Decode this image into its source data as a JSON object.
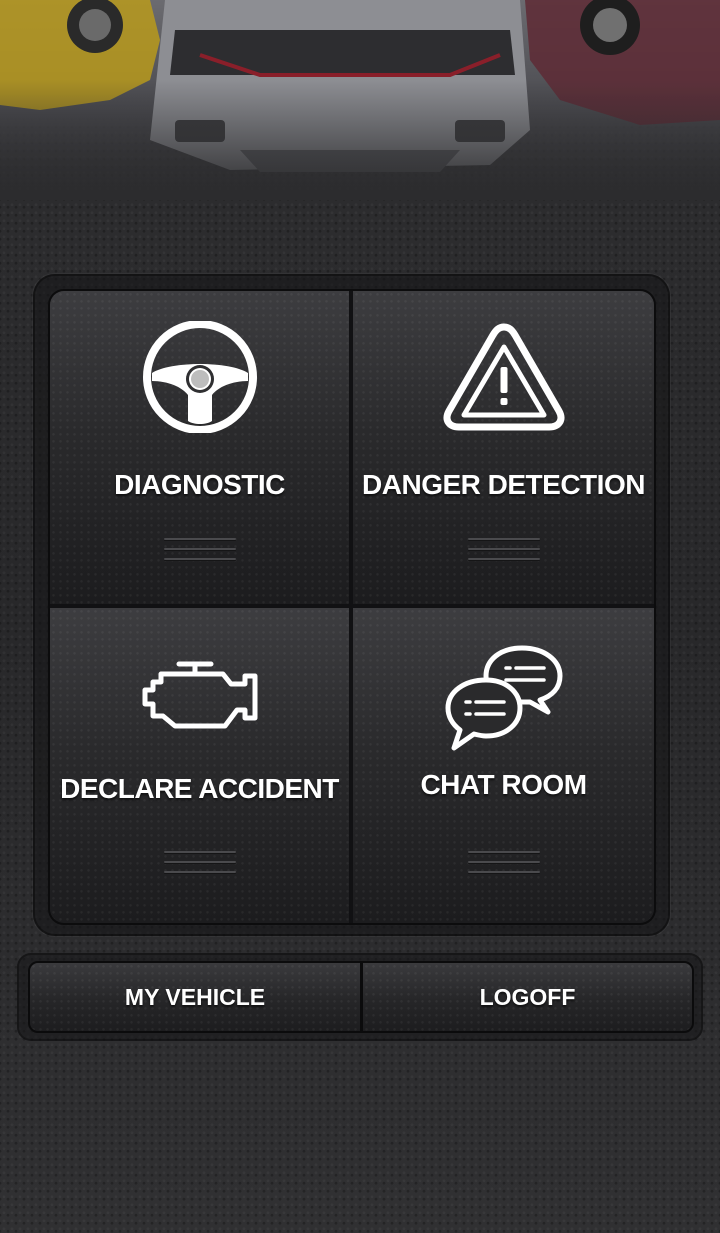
{
  "tiles": [
    {
      "label": "DIAGNOSTIC",
      "icon": "steering-wheel-icon"
    },
    {
      "label": "DANGER DETECTION",
      "icon": "warning-triangle-icon"
    },
    {
      "label": "DECLARE ACCIDENT",
      "icon": "engine-icon"
    },
    {
      "label": "CHAT ROOM",
      "icon": "chat-bubbles-icon"
    }
  ],
  "bottom_bar": {
    "my_vehicle_label": "MY VEHICLE",
    "logoff_label": "LOGOFF"
  },
  "colors": {
    "background": "#2b2b2d",
    "tile_top": "#3d3d40",
    "tile_bottom": "#1c1c1e",
    "text": "#ffffff"
  }
}
